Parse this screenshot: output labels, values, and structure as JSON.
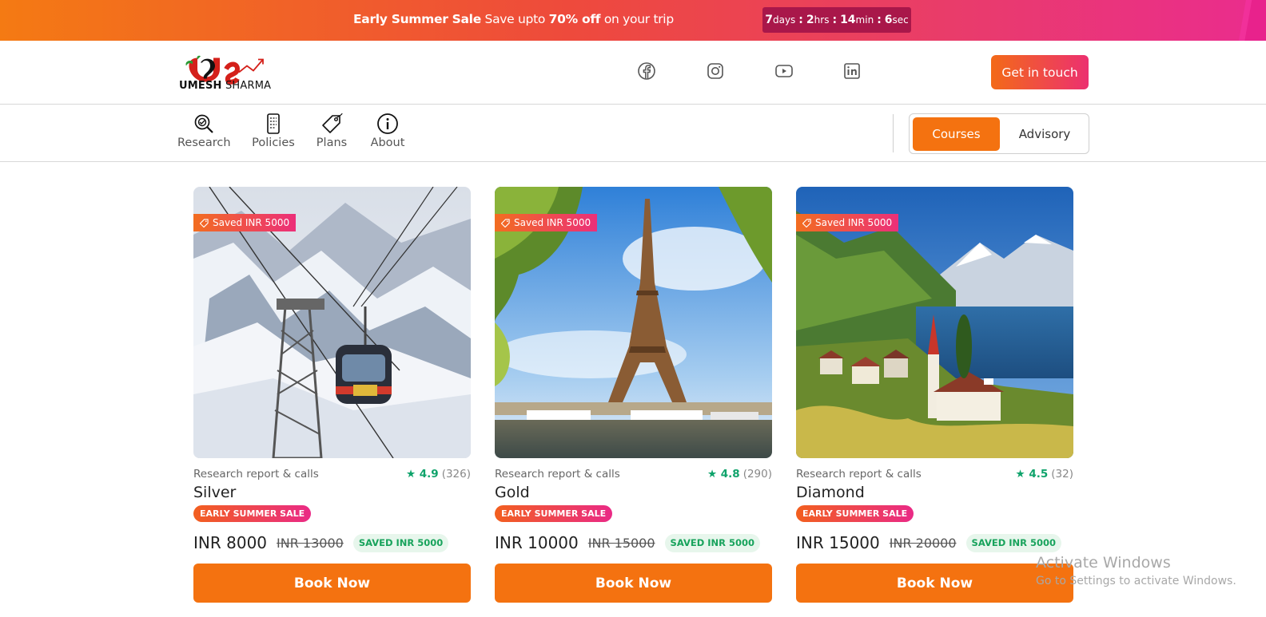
{
  "promo": {
    "title": "Early Summer Sale",
    "text_a": " Save upto ",
    "highlight": "70% off",
    "text_b": " on your trip",
    "countdown": {
      "days": "7",
      "days_unit": "days",
      "hours": "2",
      "hours_unit": "hrs",
      "mins": "14",
      "mins_unit": "min",
      "secs": "6",
      "secs_unit": "sec",
      "sep": ":"
    }
  },
  "header": {
    "logo_bold": "UMESH",
    "logo_light": " SHARMA",
    "social": [
      "facebook-icon",
      "instagram-icon",
      "youtube-icon",
      "linkedin-icon"
    ],
    "cta": "Get in touch"
  },
  "nav": {
    "items": [
      {
        "label": "Research",
        "icon": "research-icon"
      },
      {
        "label": "Policies",
        "icon": "policies-icon"
      },
      {
        "label": "Plans",
        "icon": "plans-tag-icon"
      },
      {
        "label": "About",
        "icon": "info-icon"
      }
    ],
    "toggle": {
      "active": "Courses",
      "inactive": "Advisory"
    }
  },
  "cards": [
    {
      "tag": "Saved INR 5000",
      "category": "Research report & calls",
      "rating": "4.9",
      "reviews": "(326)",
      "name": "Silver",
      "sale": "EARLY SUMMER SALE",
      "price": "INR 8000",
      "old_price": "INR 13000",
      "saved": "SAVED INR 5000",
      "cta": "Book Now"
    },
    {
      "tag": "Saved INR 5000",
      "category": "Research report & calls",
      "rating": "4.8",
      "reviews": "(290)",
      "name": "Gold",
      "sale": "EARLY SUMMER SALE",
      "price": "INR 10000",
      "old_price": "INR 15000",
      "saved": "SAVED INR 5000",
      "cta": "Book Now"
    },
    {
      "tag": "Saved INR 5000",
      "category": "Research report & calls",
      "rating": "4.5",
      "reviews": "(32)",
      "name": "Diamond",
      "sale": "EARLY SUMMER SALE",
      "price": "INR 15000",
      "old_price": "INR 20000",
      "saved": "SAVED INR 5000",
      "cta": "Book Now"
    }
  ],
  "watermark": {
    "line1": "Activate Windows",
    "line2": "Go to Settings to activate Windows."
  },
  "colors": {
    "accent": "#f47210",
    "rating": "#0fa36b",
    "countdown_bg": "#a9174a"
  }
}
